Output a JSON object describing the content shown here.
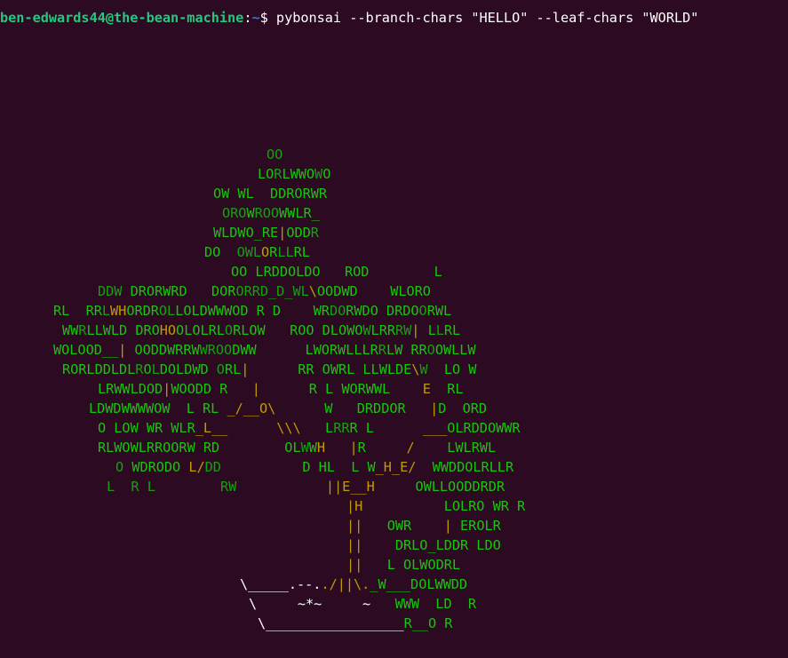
{
  "prompt": {
    "user_host": "ben-edwards44@the-bean-machine",
    "separator": ":",
    "path": "~",
    "symbol": "$ ",
    "command": "pybonsai --branch-chars \"HELLO\" --leaf-chars \"WORLD\""
  },
  "tree_lines": [
    {
      "col": 30,
      "segments": [
        [
          "g1",
          "OO"
        ]
      ]
    },
    {
      "col": 29,
      "segments": [
        [
          "g2",
          "LO"
        ],
        [
          "g1",
          "R"
        ],
        [
          "g2",
          "LWWO"
        ],
        [
          "g1",
          "W"
        ],
        [
          "g2",
          "O"
        ]
      ]
    },
    {
      "col": 24,
      "segments": [
        [
          "g2",
          "OW WL  DDRORWR"
        ]
      ]
    },
    {
      "col": 25,
      "segments": [
        [
          "g1",
          "ORO"
        ],
        [
          "g2",
          "W"
        ],
        [
          "g1",
          "ROO"
        ],
        [
          "g2",
          "WWLR_"
        ]
      ]
    },
    {
      "col": 24,
      "segments": [
        [
          "g2",
          "WLDWO_RE"
        ],
        [
          "y",
          "|"
        ],
        [
          "g2",
          "ODD"
        ],
        [
          "g1",
          "R"
        ]
      ]
    },
    {
      "col": 23,
      "segments": [
        [
          "g2",
          "DO"
        ],
        [
          "g1",
          "  OWL"
        ],
        [
          "y",
          "O"
        ],
        [
          "g2",
          "R"
        ],
        [
          "g1",
          "LL"
        ],
        [
          "g2",
          "RL"
        ]
      ]
    },
    {
      "col": 26,
      "segments": [
        [
          "g2",
          "OO LRDDOLDO   ROD        L"
        ]
      ]
    },
    {
      "col": 11,
      "segments": [
        [
          "g1",
          "DDW "
        ],
        [
          "g2",
          "DRORWRD   DOR"
        ],
        [
          "g1",
          "ORRD_D_WL"
        ],
        [
          "y",
          "\\"
        ],
        [
          "g2",
          "OODWD    WLORO"
        ]
      ]
    },
    {
      "col": 6,
      "segments": [
        [
          "g2",
          "RL  RR"
        ],
        [
          "g1",
          "L"
        ],
        [
          "y",
          "WH"
        ],
        [
          "g2",
          "ORDR"
        ],
        [
          "g1",
          "OL"
        ],
        [
          "g2",
          "LOLDWWWOD R D    WR"
        ],
        [
          "g1",
          "DO"
        ],
        [
          "g2",
          "RWDO DRDO"
        ],
        [
          "g1",
          "O"
        ],
        [
          "g2",
          "RWL"
        ]
      ]
    },
    {
      "col": 7,
      "segments": [
        [
          "g2",
          "WW"
        ],
        [
          "g1",
          "R"
        ],
        [
          "g2",
          "LLWLD DRO"
        ],
        [
          "y",
          "HO"
        ],
        [
          "g2",
          "OLOLRL"
        ],
        [
          "g1",
          "O"
        ],
        [
          "g2",
          "RLOW   ROO DLOWO"
        ],
        [
          "g1",
          "W"
        ],
        [
          "g2",
          "LRR"
        ],
        [
          "g1",
          "RW"
        ],
        [
          "y",
          "|"
        ],
        [
          "g2",
          " L"
        ],
        [
          "g1",
          "L"
        ],
        [
          "g2",
          "RL"
        ]
      ]
    },
    {
      "col": 6,
      "segments": [
        [
          "g2",
          "WOLOOD__"
        ],
        [
          "y",
          "|"
        ],
        [
          "g2",
          " OODDWRRW"
        ],
        [
          "g1",
          "WROO"
        ],
        [
          "g2",
          "DWW      LWORWLLLR"
        ],
        [
          "g1",
          "R"
        ],
        [
          "g2",
          "LW RR"
        ],
        [
          "g1",
          "O"
        ],
        [
          "g2",
          "OWLLW"
        ]
      ]
    },
    {
      "col": 7,
      "segments": [
        [
          "g2",
          "RORLDDLDL"
        ],
        [
          "g1",
          "R"
        ],
        [
          "g2",
          "O"
        ],
        [
          "g1",
          "L"
        ],
        [
          "g2",
          "DOLDWD "
        ],
        [
          "g1",
          "O"
        ],
        [
          "g2",
          "RL"
        ],
        [
          "y",
          "|"
        ],
        [
          "g2",
          "      RR OWRL LLWLDE"
        ],
        [
          "y",
          "\\"
        ],
        [
          "g1",
          "W"
        ],
        [
          "g2",
          "  LO W"
        ]
      ]
    },
    {
      "col": 11,
      "segments": [
        [
          "g2",
          "LRWWLDOD"
        ],
        [
          "y",
          "|"
        ],
        [
          "g2",
          "WOODD R   "
        ],
        [
          "y",
          "|"
        ],
        [
          "g2",
          "      R L WORWWL    "
        ],
        [
          "y",
          "E"
        ],
        [
          "g2",
          "  RL"
        ]
      ]
    },
    {
      "col": 10,
      "segments": [
        [
          "g2",
          "LDWDWWWWOW  L RL "
        ],
        [
          "y",
          "_/__O\\"
        ],
        [
          "g2",
          "      W   DRDDOR   "
        ],
        [
          "y",
          "|"
        ],
        [
          "g2",
          "D  ORD"
        ]
      ]
    },
    {
      "col": 11,
      "segments": [
        [
          "g2",
          "O LOW WR WLR"
        ],
        [
          "y",
          "_L__"
        ],
        [
          "g2",
          "      "
        ],
        [
          "y",
          "\\\\\\"
        ],
        [
          "g2",
          "   L"
        ],
        [
          "g1",
          "RR"
        ],
        [
          "g2",
          "R L      "
        ],
        [
          "y",
          "___"
        ],
        [
          "g2",
          "OLRDDOWWR"
        ]
      ]
    },
    {
      "col": 11,
      "segments": [
        [
          "g2",
          "RLWOWLRROORW RD        OL"
        ],
        [
          "g1",
          "W"
        ],
        [
          "g2",
          "W"
        ],
        [
          "y",
          "H"
        ],
        [
          "g2",
          "   "
        ],
        [
          "y",
          "|"
        ],
        [
          "g2",
          "R     "
        ],
        [
          "y",
          "/"
        ],
        [
          "g2",
          "    LWLRWL"
        ]
      ]
    },
    {
      "col": 13,
      "segments": [
        [
          "g1",
          "O "
        ],
        [
          "g2",
          "WDRODO "
        ],
        [
          "y",
          "L/"
        ],
        [
          "g1",
          "DD"
        ],
        [
          "g2",
          "          D HL  L W"
        ],
        [
          "y",
          "_H_E/"
        ],
        [
          "g2",
          "  WWDDOLRLLR"
        ]
      ]
    },
    {
      "col": 12,
      "segments": [
        [
          "g1",
          "L  R L        RW           "
        ],
        [
          "y",
          "||E__H"
        ],
        [
          "g2",
          "     OWLLOODDRDR"
        ]
      ]
    },
    {
      "col": 39,
      "segments": [
        [
          "y",
          "|H"
        ],
        [
          "g2",
          "          LOLRO WR R"
        ]
      ]
    },
    {
      "col": 39,
      "segments": [
        [
          "y",
          "||"
        ],
        [
          "g2",
          "   OWR    "
        ],
        [
          "y",
          "|"
        ],
        [
          "g2",
          " EROLR"
        ]
      ]
    },
    {
      "col": 39,
      "segments": [
        [
          "y",
          "||"
        ],
        [
          "g2",
          "    DRLO_LDDR LDO"
        ]
      ]
    },
    {
      "col": 39,
      "segments": [
        [
          "y",
          "||"
        ],
        [
          "g2",
          "   L OLWODRL"
        ]
      ]
    },
    {
      "col": 27,
      "segments": [
        [
          "pot",
          "\\_____.-"
        ],
        [
          "pot",
          "-."
        ],
        [
          "y",
          "./||\\."
        ],
        [
          "g2",
          "_W___DOLWWDD"
        ]
      ]
    },
    {
      "col": 28,
      "segments": [
        [
          "pot",
          "\\     ~*~     ~   "
        ],
        [
          "g2",
          "WWW  LD  R"
        ]
      ]
    },
    {
      "col": 29,
      "segments": [
        [
          "pot",
          "\\_________________"
        ],
        [
          "g2",
          "R__O R"
        ]
      ]
    }
  ],
  "colors": {
    "background": "#2c0a22",
    "prompt_user": "#26c77e",
    "prompt_path": "#3e77cc",
    "leaf_dark": "#13a10e",
    "leaf_light": "#16c60c",
    "branch": "#c19c00",
    "pot": "#ffffff"
  }
}
